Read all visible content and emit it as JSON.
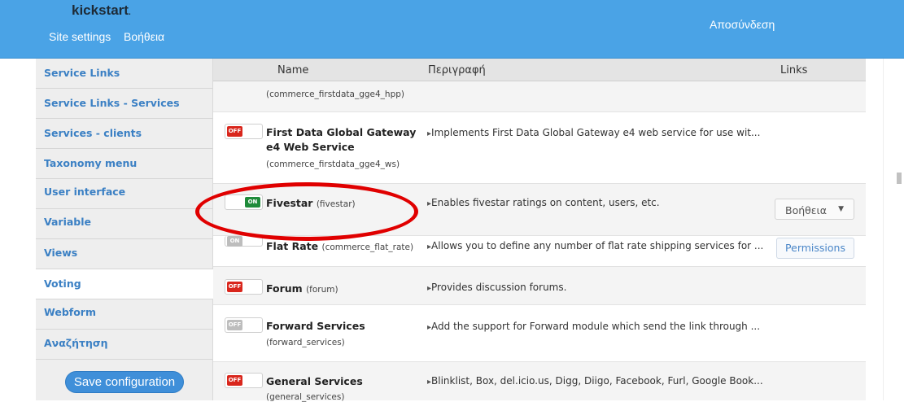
{
  "topbar": {
    "brand": "kickstart",
    "site_settings": "Site settings",
    "help": "Βοήθεια",
    "logout": "Αποσύνδεση"
  },
  "sidebar": {
    "items": [
      {
        "label": "Service Links"
      },
      {
        "label": "Service Links - Services"
      },
      {
        "label": "Services - clients"
      },
      {
        "label": "Taxonomy menu"
      },
      {
        "label": "User interface"
      },
      {
        "label": "Variable"
      },
      {
        "label": "Views"
      },
      {
        "label": "Voting"
      },
      {
        "label": "Webform"
      },
      {
        "label": "Αναζήτηση"
      }
    ],
    "save_label": "Save configuration"
  },
  "table": {
    "headers": {
      "name": "Name",
      "description": "Περιγραφή",
      "links": "Links"
    },
    "rows": [
      {
        "machine": "(commerce_firstdata_gge4_hpp)"
      },
      {
        "toggle": "OFF",
        "name_line1": "First Data Global Gateway",
        "name_line2": "e4 Web Service",
        "machine": "(commerce_firstdata_gge4_ws)",
        "description": "Implements First Data Global Gateway e4 web service for use wit..."
      },
      {
        "toggle": "ON",
        "name": "Fivestar",
        "machine": "(fivestar)",
        "description": "Enables fivestar ratings on content, users, etc.",
        "link": "Βοήθεια"
      },
      {
        "toggle": "ON",
        "name": "Flat Rate",
        "machine": "(commerce_flat_rate)",
        "description": "Allows you to define any number of flat rate shipping services for ...",
        "link": "Permissions"
      },
      {
        "toggle": "OFF",
        "name": "Forum",
        "machine": "(forum)",
        "description": "Provides discussion forums."
      },
      {
        "toggle": "OFF",
        "name": "Forward Services",
        "machine": "(forward_services)",
        "description": "Add the support for Forward module which send the link through ..."
      },
      {
        "toggle": "OFF",
        "name": "General Services",
        "machine": "(general_services)",
        "description": "Blinklist, Box, del.icio.us, Digg, Diigo, Facebook, Furl, Google Book..."
      }
    ]
  },
  "colors": {
    "topbar": "#4aa3e6",
    "link": "#3b80c4",
    "off": "#d9261c",
    "on": "#1f8b3a",
    "annotation": "#e00000"
  }
}
